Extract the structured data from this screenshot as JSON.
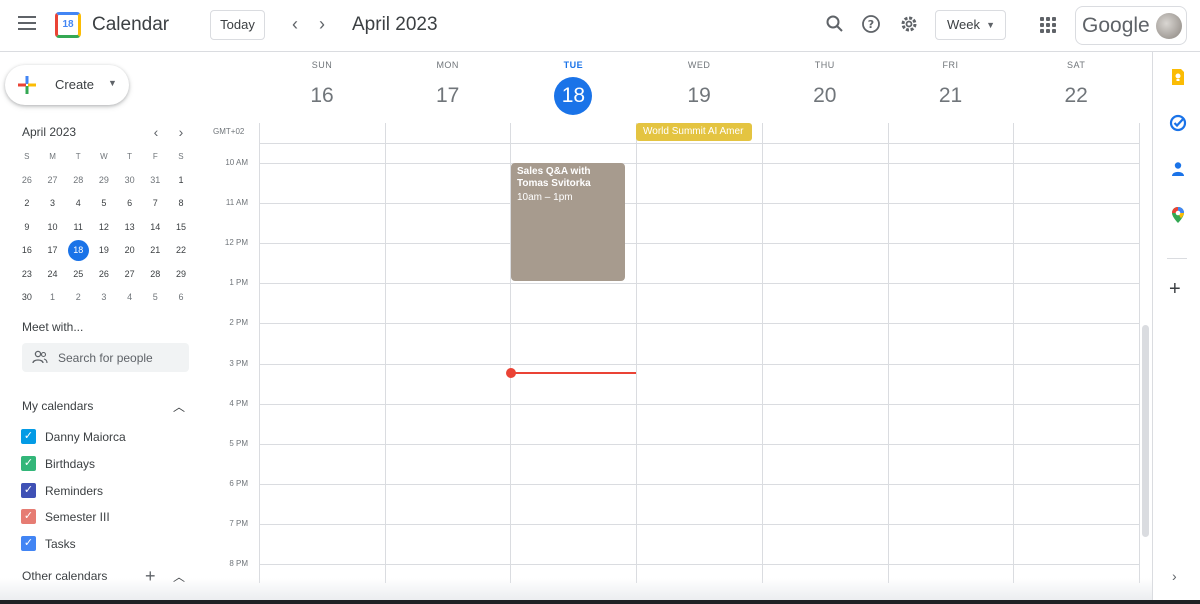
{
  "header": {
    "app_title": "Calendar",
    "logo_day": "18",
    "today_label": "Today",
    "prev_icon": "chevron-left-icon",
    "next_icon": "chevron-right-icon",
    "month_title": "April 2023",
    "view_label": "Week",
    "brand": "Google"
  },
  "sidebar": {
    "create_label": "Create",
    "mini_calendar": {
      "title": "April 2023",
      "weekday_heads": [
        "S",
        "M",
        "T",
        "W",
        "T",
        "F",
        "S"
      ],
      "weeks": [
        [
          "26",
          "27",
          "28",
          "29",
          "30",
          "31",
          "1"
        ],
        [
          "2",
          "3",
          "4",
          "5",
          "6",
          "7",
          "8"
        ],
        [
          "9",
          "10",
          "11",
          "12",
          "13",
          "14",
          "15"
        ],
        [
          "16",
          "17",
          "18",
          "19",
          "20",
          "21",
          "22"
        ],
        [
          "23",
          "24",
          "25",
          "26",
          "27",
          "28",
          "29"
        ],
        [
          "30",
          "1",
          "2",
          "3",
          "4",
          "5",
          "6"
        ]
      ],
      "today": "18"
    },
    "meet_title": "Meet with...",
    "search_placeholder": "Search for people",
    "my_calendars_title": "My calendars",
    "my_calendars": [
      {
        "label": "Danny Maiorca",
        "color": "#039be5"
      },
      {
        "label": "Birthdays",
        "color": "#33b679"
      },
      {
        "label": "Reminders",
        "color": "#3f51b5"
      },
      {
        "label": "Semester III",
        "color": "#e67c73"
      },
      {
        "label": "Tasks",
        "color": "#4285f4"
      }
    ],
    "other_calendars_title": "Other calendars"
  },
  "week": {
    "days": [
      {
        "dow": "SUN",
        "num": "16"
      },
      {
        "dow": "MON",
        "num": "17"
      },
      {
        "dow": "TUE",
        "num": "18"
      },
      {
        "dow": "WED",
        "num": "19"
      },
      {
        "dow": "THU",
        "num": "20"
      },
      {
        "dow": "FRI",
        "num": "21"
      },
      {
        "dow": "SAT",
        "num": "22"
      }
    ],
    "today_index": 2,
    "timezone": "GMT+02",
    "hours": [
      "10 AM",
      "11 AM",
      "12 PM",
      "1 PM",
      "2 PM",
      "3 PM",
      "4 PM",
      "5 PM",
      "6 PM",
      "7 PM",
      "8 PM"
    ]
  },
  "events": {
    "allday": {
      "title": "World Summit AI Amer",
      "color": "#e4c441"
    },
    "timed": {
      "title": "Sales Q&A with Tomas Svitorka",
      "time": "10am – 1pm",
      "color": "#a79b8e"
    }
  },
  "colors": {
    "accent": "#1a73e8",
    "now_line": "#ea4335"
  }
}
